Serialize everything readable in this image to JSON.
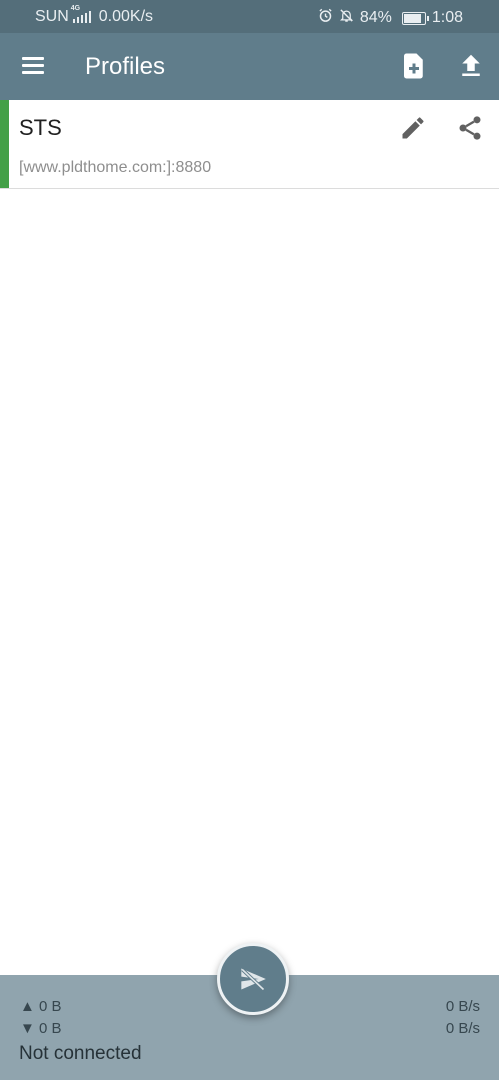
{
  "status_bar": {
    "carrier": "SUN",
    "network_type": "4G",
    "speed": "0.00K/s",
    "battery_percent": "84%",
    "battery_level": 0.84,
    "time": "1:08"
  },
  "app_bar": {
    "title": "Profiles",
    "icons": [
      "menu-icon",
      "add-file-icon",
      "upload-icon"
    ]
  },
  "profiles": [
    {
      "name": "STS",
      "server": "[www.pldthome.com:]:8880",
      "indicator_color": "#43a047"
    }
  ],
  "bottom_bar": {
    "upload_total": "▲ 0 B",
    "download_total": "▼ 0 B",
    "upload_rate": "0 B/s",
    "download_rate": "0 B/s",
    "status": "Not connected"
  },
  "colors": {
    "primary": "#607d8b",
    "primary_dark": "#546e7a",
    "bottom_bar": "#90a4ae",
    "active_indicator": "#43a047"
  }
}
